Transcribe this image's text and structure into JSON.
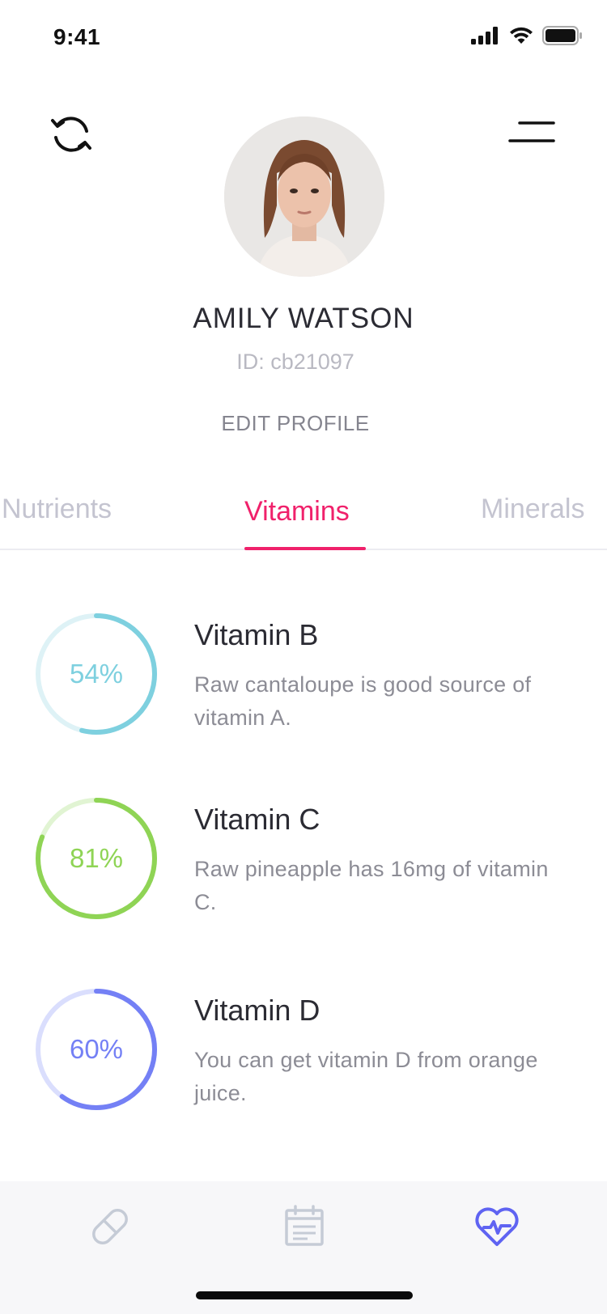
{
  "status_bar": {
    "time": "9:41"
  },
  "profile": {
    "name": "AMILY WATSON",
    "id_text": "ID: cb21097",
    "edit_label": "EDIT PROFILE"
  },
  "tabs": [
    {
      "label": "Nutrients",
      "active": false
    },
    {
      "label": "Vitamins",
      "active": true
    },
    {
      "label": "Minerals",
      "active": false
    }
  ],
  "vitamins": [
    {
      "title": "Vitamin B",
      "percent_label": "54%",
      "percent": 54,
      "description": "Raw cantaloupe is good source of vitamin A.",
      "color": "#7ed0df",
      "track_color": "#def2f6"
    },
    {
      "title": "Vitamin C",
      "percent_label": "81%",
      "percent": 81,
      "description": "Raw pineapple has 16mg of vitamin C.",
      "color": "#8fd455",
      "track_color": "#e1f4d3"
    },
    {
      "title": "Vitamin D",
      "percent_label": "60%",
      "percent": 60,
      "description": "You can get vitamin D from orange juice.",
      "color": "#7480f5",
      "track_color": "#dadefd"
    }
  ],
  "bottom_nav": [
    {
      "icon": "pill-icon",
      "active": false
    },
    {
      "icon": "calendar-icon",
      "active": false
    },
    {
      "icon": "heart-pulse-icon",
      "active": true
    }
  ],
  "colors": {
    "accent": "#f0216b",
    "nav_active": "#5f63f2",
    "nav_inactive": "#c5cbd6"
  }
}
